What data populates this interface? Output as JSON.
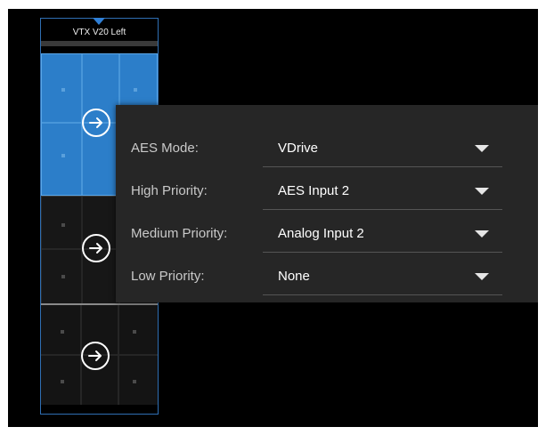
{
  "column": {
    "title": "VTX V20 Left",
    "pointer_icon": "caret-down-icon",
    "arrow_icon": "arrow-right-icon",
    "accent": "#2c7ec9"
  },
  "panel": {
    "rows": [
      {
        "label": "AES Mode:",
        "value": "VDrive"
      },
      {
        "label": "High Priority:",
        "value": "AES Input 2"
      },
      {
        "label": "Medium Priority:",
        "value": "Analog Input 2"
      },
      {
        "label": "Low Priority:",
        "value": "None"
      }
    ]
  }
}
